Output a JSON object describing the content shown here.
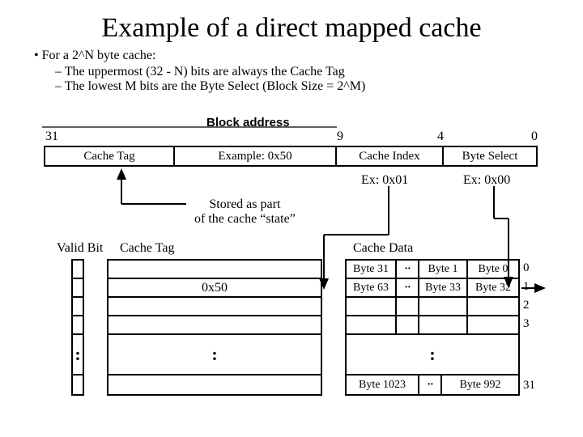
{
  "title": "Example of a direct mapped cache",
  "bullets": {
    "main": "For a 2^N byte cache:",
    "sub1": "The uppermost (32 - N) bits are always the Cache Tag",
    "sub2": "The lowest M bits are the Byte Select (Block Size = 2^M)"
  },
  "block_addr_label": "Block address",
  "bits": {
    "b31": "31",
    "b9": "9",
    "b4": "4",
    "b0": "0"
  },
  "addr": {
    "cache_tag": "Cache Tag",
    "example": "Example: 0x50",
    "cache_index": "Cache Index",
    "byte_select": "Byte Select"
  },
  "ex": {
    "idx": "Ex: 0x01",
    "bs": "Ex: 0x00"
  },
  "stored_note_l1": "Stored as part",
  "stored_note_l2": "of the cache “state”",
  "labels": {
    "valid": "Valid Bit",
    "tag": "Cache Tag",
    "data": "Cache Data"
  },
  "tag_col": {
    "val": "0x50"
  },
  "data_rows": {
    "r0": {
      "a": "Byte 31",
      "b": "··",
      "c": "Byte 1",
      "d": "Byte 0"
    },
    "r1": {
      "a": "Byte 63",
      "b": "··",
      "c": "Byte 33",
      "d": "Byte 32"
    },
    "rlast": {
      "a": "Byte 1023",
      "b": "··",
      "d": "Byte 992"
    }
  },
  "row_nums": {
    "n0": "0",
    "n1": "1",
    "n2": "2",
    "n3": "3",
    "n31": "31"
  },
  "glyphs": {
    "colon": ":"
  }
}
